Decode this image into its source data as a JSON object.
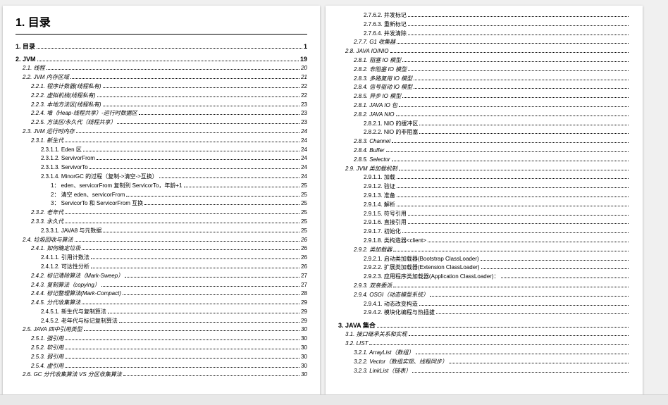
{
  "heading": "1. 目录",
  "left_entries": [
    {
      "lvl": 1,
      "num": "1.",
      "label": "目录",
      "page": "1"
    },
    {
      "lvl": 1,
      "num": "2.",
      "label": "JVM",
      "page": "19"
    },
    {
      "lvl": 2,
      "num": "2.1.",
      "label": "线程",
      "page": "20"
    },
    {
      "lvl": 2,
      "num": "2.2.",
      "label": "JVM 内存区域",
      "page": "21"
    },
    {
      "lvl": 3,
      "num": "2.2.1.",
      "label": "程序计数器(线程私有)",
      "page": "22"
    },
    {
      "lvl": 3,
      "num": "2.2.2.",
      "label": "虚拟机栈(线程私有)",
      "page": "22"
    },
    {
      "lvl": 3,
      "num": "2.2.3.",
      "label": "本地方法区(线程私有)",
      "page": "23"
    },
    {
      "lvl": 3,
      "num": "2.2.4.",
      "label": "堆（Heap-线程共享）-运行时数据区",
      "page": "23"
    },
    {
      "lvl": 3,
      "num": "2.2.5.",
      "label": "方法区/永久代（线程共享）",
      "page": "23"
    },
    {
      "lvl": 2,
      "num": "2.3.",
      "label": "JVM 运行时内存",
      "page": "24"
    },
    {
      "lvl": 3,
      "num": "2.3.1.",
      "label": "新生代",
      "page": "24"
    },
    {
      "lvl": 4,
      "num": "2.3.1.1.",
      "label": "Eden 区",
      "page": "24"
    },
    {
      "lvl": 4,
      "num": "2.3.1.2.",
      "label": "ServivorFrom",
      "page": "24"
    },
    {
      "lvl": 4,
      "num": "2.3.1.3.",
      "label": "ServivorTo",
      "page": "24"
    },
    {
      "lvl": 4,
      "num": "2.3.1.4.",
      "label": "MinorGC 的过程（复制->清空->互换）",
      "page": "24"
    },
    {
      "lvl": 5,
      "num": "1：",
      "label": "eden、servicorFrom 复制到 ServicorTo，年龄+1",
      "page": "25"
    },
    {
      "lvl": 5,
      "num": "2：",
      "label": "清空 eden、servicorFrom",
      "page": "25"
    },
    {
      "lvl": 5,
      "num": "3：",
      "label": "ServicorTo 和 ServicorFrom 互换",
      "page": "25"
    },
    {
      "lvl": 3,
      "num": "2.3.2.",
      "label": "老年代",
      "page": "25"
    },
    {
      "lvl": 3,
      "num": "2.3.3.",
      "label": "永久代",
      "page": "25"
    },
    {
      "lvl": 4,
      "num": "2.3.3.1.",
      "label": "JAVA8 与元数据",
      "page": "25"
    },
    {
      "lvl": 2,
      "num": "2.4.",
      "label": "垃圾回收与算法",
      "page": "26"
    },
    {
      "lvl": 3,
      "num": "2.4.1.",
      "label": "如何确定垃圾",
      "page": "26"
    },
    {
      "lvl": 4,
      "num": "2.4.1.1.",
      "label": "引用计数法",
      "page": "26"
    },
    {
      "lvl": 4,
      "num": "2.4.1.2.",
      "label": "可达性分析",
      "page": "26"
    },
    {
      "lvl": 3,
      "num": "2.4.2.",
      "label": "标记清除算法（Mark-Sweep）",
      "page": "27"
    },
    {
      "lvl": 3,
      "num": "2.4.3.",
      "label": "复制算法（copying）",
      "page": "27"
    },
    {
      "lvl": 3,
      "num": "2.4.4.",
      "label": "标记整理算法(Mark-Compact)",
      "page": "28"
    },
    {
      "lvl": 3,
      "num": "2.4.5.",
      "label": "分代收集算法",
      "page": "29"
    },
    {
      "lvl": 4,
      "num": "2.4.5.1.",
      "label": "新生代与复制算法",
      "page": "29"
    },
    {
      "lvl": 4,
      "num": "2.4.5.2.",
      "label": "老年代与标记复制算法",
      "page": "29"
    },
    {
      "lvl": 2,
      "num": "2.5.",
      "label": "JAVA 四中引用类型",
      "page": "30"
    },
    {
      "lvl": 3,
      "num": "2.5.1.",
      "label": "强引用",
      "page": "30"
    },
    {
      "lvl": 3,
      "num": "2.5.2.",
      "label": "软引用",
      "page": "30"
    },
    {
      "lvl": 3,
      "num": "2.5.3.",
      "label": "弱引用",
      "page": "30"
    },
    {
      "lvl": 3,
      "num": "2.5.4.",
      "label": "虚引用",
      "page": "30"
    },
    {
      "lvl": 2,
      "num": "2.6.",
      "label": "GC 分代收集算法 VS 分区收集算法",
      "page": "30"
    }
  ],
  "right_entries": [
    {
      "lvl": 4,
      "num": "2.7.6.2.",
      "label": "并发标记",
      "page": ""
    },
    {
      "lvl": 4,
      "num": "2.7.6.3.",
      "label": "重新标记",
      "page": ""
    },
    {
      "lvl": 4,
      "num": "2.7.6.4.",
      "label": "并发清除",
      "page": ""
    },
    {
      "lvl": 3,
      "num": "2.7.7.",
      "label": "G1 收集器",
      "page": ""
    },
    {
      "lvl": 2,
      "num": "2.8.",
      "label": "JAVA IO/NIO",
      "page": ""
    },
    {
      "lvl": 3,
      "num": "2.8.1.",
      "label": "阻塞 IO 模型",
      "page": ""
    },
    {
      "lvl": 3,
      "num": "2.8.2.",
      "label": "非阻塞 IO 模型",
      "page": ""
    },
    {
      "lvl": 3,
      "num": "2.8.3.",
      "label": "多路复用 IO 模型",
      "page": ""
    },
    {
      "lvl": 3,
      "num": "2.8.4.",
      "label": "信号驱动 IO 模型",
      "page": ""
    },
    {
      "lvl": 3,
      "num": "2.8.5.",
      "label": "异步 IO 模型",
      "page": ""
    },
    {
      "lvl": 3,
      "num": "2.8.1.",
      "label": "JAVA IO 包",
      "page": ""
    },
    {
      "lvl": 3,
      "num": "2.8.2.",
      "label": "JAVA NIO",
      "page": ""
    },
    {
      "lvl": 4,
      "num": "2.8.2.1.",
      "label": "NIO 的缓冲区",
      "page": ""
    },
    {
      "lvl": 4,
      "num": "2.8.2.2.",
      "label": "NIO 的非阻塞",
      "page": ""
    },
    {
      "lvl": 3,
      "num": "2.8.3.",
      "label": "Channel",
      "page": ""
    },
    {
      "lvl": 3,
      "num": "2.8.4.",
      "label": "Buffer",
      "page": ""
    },
    {
      "lvl": 3,
      "num": "2.8.5.",
      "label": "Selector",
      "page": ""
    },
    {
      "lvl": 2,
      "num": "2.9.",
      "label": "JVM 类加载机制",
      "page": ""
    },
    {
      "lvl": 4,
      "num": "2.9.1.1.",
      "label": "加载",
      "page": ""
    },
    {
      "lvl": 4,
      "num": "2.9.1.2.",
      "label": "验证",
      "page": ""
    },
    {
      "lvl": 4,
      "num": "2.9.1.3.",
      "label": "准备",
      "page": ""
    },
    {
      "lvl": 4,
      "num": "2.9.1.4.",
      "label": "解析",
      "page": ""
    },
    {
      "lvl": 4,
      "num": "2.9.1.5.",
      "label": "符号引用",
      "page": ""
    },
    {
      "lvl": 4,
      "num": "2.9.1.6.",
      "label": "直接引用",
      "page": ""
    },
    {
      "lvl": 4,
      "num": "2.9.1.7.",
      "label": "初始化",
      "page": ""
    },
    {
      "lvl": 4,
      "num": "2.9.1.8.",
      "label": "类构造器<client>",
      "page": ""
    },
    {
      "lvl": 3,
      "num": "2.9.2.",
      "label": "类加载器",
      "page": ""
    },
    {
      "lvl": 4,
      "num": "2.9.2.1.",
      "label": "启动类加载器(Bootstrap ClassLoader)",
      "page": ""
    },
    {
      "lvl": 4,
      "num": "2.9.2.2.",
      "label": "扩展类加载器(Extension ClassLoader)",
      "page": ""
    },
    {
      "lvl": 4,
      "num": "2.9.2.3.",
      "label": "应用程序类加载器(Application ClassLoader)：",
      "page": ""
    },
    {
      "lvl": 3,
      "num": "2.9.3.",
      "label": "双亲委派",
      "page": ""
    },
    {
      "lvl": 3,
      "num": "2.9.4.",
      "label": "OSGI（动态模型系统）",
      "page": ""
    },
    {
      "lvl": 4,
      "num": "2.9.4.1.",
      "label": "动态改变构造",
      "page": ""
    },
    {
      "lvl": 4,
      "num": "2.9.4.2.",
      "label": "模块化编程与热插拔",
      "page": ""
    },
    {
      "lvl": 1,
      "num": "3.",
      "label": "JAVA 集合",
      "page": ""
    },
    {
      "lvl": 2,
      "num": "3.1.",
      "label": "接口继承关系和实现",
      "page": ""
    },
    {
      "lvl": 2,
      "num": "3.2.",
      "label": "LIST",
      "page": ""
    },
    {
      "lvl": 3,
      "num": "3.2.1.",
      "label": "ArrayList（数组）",
      "page": ""
    },
    {
      "lvl": 3,
      "num": "3.2.2.",
      "label": "Vector（数组实现、线程同步）",
      "page": ""
    },
    {
      "lvl": 3,
      "num": "3.2.3.",
      "label": "LinkList（链表）",
      "page": ""
    }
  ]
}
